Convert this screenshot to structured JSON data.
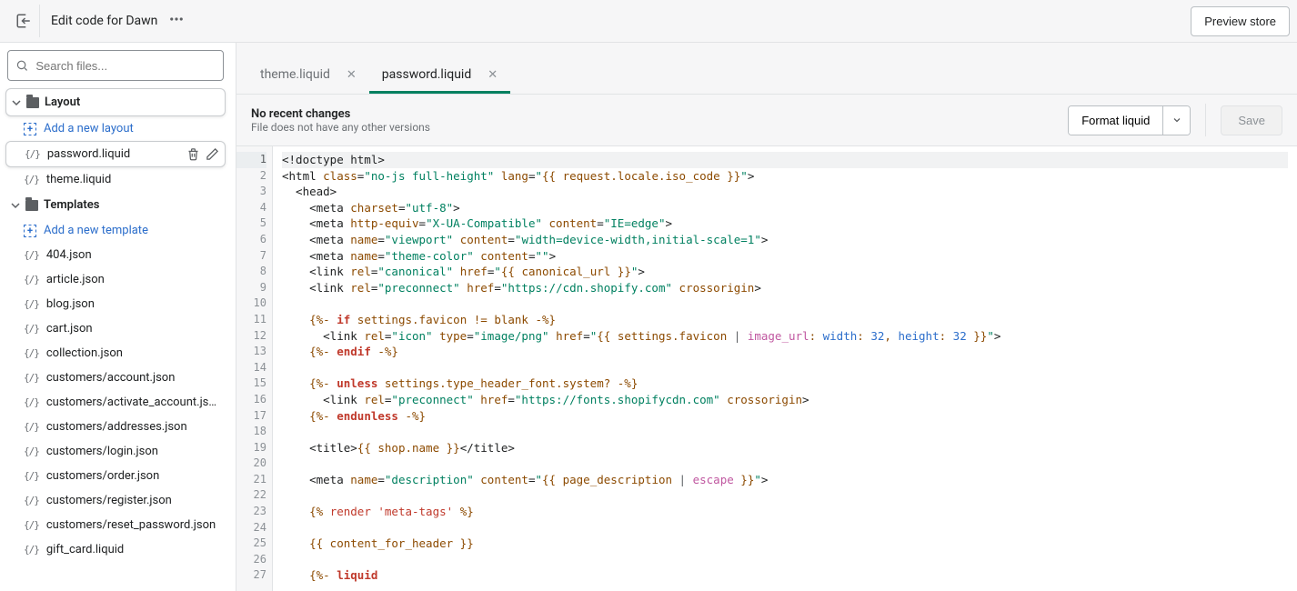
{
  "topbar": {
    "title": "Edit code for Dawn",
    "preview_label": "Preview store"
  },
  "search": {
    "placeholder": "Search files..."
  },
  "sidebar": {
    "folders": [
      {
        "name": "Layout",
        "highlighted": true,
        "add_label": "Add a new layout",
        "files": [
          {
            "name": "password.liquid",
            "active": true
          },
          {
            "name": "theme.liquid"
          }
        ]
      },
      {
        "name": "Templates",
        "add_label": "Add a new template",
        "files": [
          {
            "name": "404.json"
          },
          {
            "name": "article.json"
          },
          {
            "name": "blog.json"
          },
          {
            "name": "cart.json"
          },
          {
            "name": "collection.json"
          },
          {
            "name": "customers/account.json"
          },
          {
            "name": "customers/activate_account.json"
          },
          {
            "name": "customers/addresses.json"
          },
          {
            "name": "customers/login.json"
          },
          {
            "name": "customers/order.json"
          },
          {
            "name": "customers/register.json"
          },
          {
            "name": "customers/reset_password.json"
          },
          {
            "name": "gift_card.liquid"
          }
        ]
      }
    ]
  },
  "tabs": [
    {
      "label": "theme.liquid",
      "active": false
    },
    {
      "label": "password.liquid",
      "active": true
    }
  ],
  "infobar": {
    "heading": "No recent changes",
    "sub": "File does not have any other versions",
    "format_label": "Format liquid",
    "save_label": "Save"
  },
  "code": {
    "selected_line": 1,
    "lines": [
      [
        [
          "t-tag",
          "<!doctype html>"
        ]
      ],
      [
        [
          "t-tag",
          "<html "
        ],
        [
          "t-attr",
          "class"
        ],
        [
          "t-tag",
          "="
        ],
        [
          "t-str",
          "\"no-js full-height\""
        ],
        [
          "t-tag",
          " "
        ],
        [
          "t-attr",
          "lang"
        ],
        [
          "t-tag",
          "="
        ],
        [
          "t-str",
          "\""
        ],
        [
          "t-obj",
          "{{ request.locale.iso_code }}"
        ],
        [
          "t-str",
          "\""
        ],
        [
          "t-tag",
          ">"
        ]
      ],
      [
        [
          "t-tag",
          "  <head>"
        ]
      ],
      [
        [
          "t-tag",
          "    <meta "
        ],
        [
          "t-attr",
          "charset"
        ],
        [
          "t-tag",
          "="
        ],
        [
          "t-str",
          "\"utf-8\""
        ],
        [
          "t-tag",
          ">"
        ]
      ],
      [
        [
          "t-tag",
          "    <meta "
        ],
        [
          "t-attr",
          "http-equiv"
        ],
        [
          "t-tag",
          "="
        ],
        [
          "t-str",
          "\"X-UA-Compatible\""
        ],
        [
          "t-tag",
          " "
        ],
        [
          "t-attr",
          "content"
        ],
        [
          "t-tag",
          "="
        ],
        [
          "t-str",
          "\"IE=edge\""
        ],
        [
          "t-tag",
          ">"
        ]
      ],
      [
        [
          "t-tag",
          "    <meta "
        ],
        [
          "t-attr",
          "name"
        ],
        [
          "t-tag",
          "="
        ],
        [
          "t-str",
          "\"viewport\""
        ],
        [
          "t-tag",
          " "
        ],
        [
          "t-attr",
          "content"
        ],
        [
          "t-tag",
          "="
        ],
        [
          "t-str",
          "\"width=device-width,initial-scale=1\""
        ],
        [
          "t-tag",
          ">"
        ]
      ],
      [
        [
          "t-tag",
          "    <meta "
        ],
        [
          "t-attr",
          "name"
        ],
        [
          "t-tag",
          "="
        ],
        [
          "t-str",
          "\"theme-color\""
        ],
        [
          "t-tag",
          " "
        ],
        [
          "t-attr",
          "content"
        ],
        [
          "t-tag",
          "="
        ],
        [
          "t-str",
          "\"\""
        ],
        [
          "t-tag",
          ">"
        ]
      ],
      [
        [
          "t-tag",
          "    <link "
        ],
        [
          "t-attr",
          "rel"
        ],
        [
          "t-tag",
          "="
        ],
        [
          "t-str",
          "\"canonical\""
        ],
        [
          "t-tag",
          " "
        ],
        [
          "t-attr",
          "href"
        ],
        [
          "t-tag",
          "="
        ],
        [
          "t-str",
          "\""
        ],
        [
          "t-obj",
          "{{ canonical_url }}"
        ],
        [
          "t-str",
          "\""
        ],
        [
          "t-tag",
          ">"
        ]
      ],
      [
        [
          "t-tag",
          "    <link "
        ],
        [
          "t-attr",
          "rel"
        ],
        [
          "t-tag",
          "="
        ],
        [
          "t-str",
          "\"preconnect\""
        ],
        [
          "t-tag",
          " "
        ],
        [
          "t-attr",
          "href"
        ],
        [
          "t-tag",
          "="
        ],
        [
          "t-str",
          "\"https://cdn.shopify.com\""
        ],
        [
          "t-tag",
          " "
        ],
        [
          "t-attr",
          "crossorigin"
        ],
        [
          "t-tag",
          ">"
        ]
      ],
      [],
      [
        [
          "t-liq",
          "    {%- "
        ],
        [
          "t-kw",
          "if"
        ],
        [
          "t-liq",
          " settings.favicon != blank -%}"
        ]
      ],
      [
        [
          "t-tag",
          "      <link "
        ],
        [
          "t-attr",
          "rel"
        ],
        [
          "t-tag",
          "="
        ],
        [
          "t-str",
          "\"icon\""
        ],
        [
          "t-tag",
          " "
        ],
        [
          "t-attr",
          "type"
        ],
        [
          "t-tag",
          "="
        ],
        [
          "t-str",
          "\"image/png\""
        ],
        [
          "t-tag",
          " "
        ],
        [
          "t-attr",
          "href"
        ],
        [
          "t-tag",
          "="
        ],
        [
          "t-str",
          "\""
        ],
        [
          "t-obj",
          "{{ settings.favicon "
        ],
        [
          "t-pipe",
          "| "
        ],
        [
          "t-filter",
          "image_url"
        ],
        [
          "t-obj",
          ": "
        ],
        [
          "t-prop",
          "width"
        ],
        [
          "t-obj",
          ": "
        ],
        [
          "t-num",
          "32"
        ],
        [
          "t-obj",
          ", "
        ],
        [
          "t-prop",
          "height"
        ],
        [
          "t-obj",
          ": "
        ],
        [
          "t-num",
          "32"
        ],
        [
          "t-obj",
          " }}"
        ],
        [
          "t-str",
          "\""
        ],
        [
          "t-tag",
          ">"
        ]
      ],
      [
        [
          "t-liq",
          "    {%- "
        ],
        [
          "t-kw",
          "endif"
        ],
        [
          "t-liq",
          " -%}"
        ]
      ],
      [],
      [
        [
          "t-liq",
          "    {%- "
        ],
        [
          "t-kw",
          "unless"
        ],
        [
          "t-liq",
          " settings.type_header_font.system? -%}"
        ]
      ],
      [
        [
          "t-tag",
          "      <link "
        ],
        [
          "t-attr",
          "rel"
        ],
        [
          "t-tag",
          "="
        ],
        [
          "t-str",
          "\"preconnect\""
        ],
        [
          "t-tag",
          " "
        ],
        [
          "t-attr",
          "href"
        ],
        [
          "t-tag",
          "="
        ],
        [
          "t-str",
          "\"https://fonts.shopifycdn.com\""
        ],
        [
          "t-tag",
          " "
        ],
        [
          "t-attr",
          "crossorigin"
        ],
        [
          "t-tag",
          ">"
        ]
      ],
      [
        [
          "t-liq",
          "    {%- "
        ],
        [
          "t-kw",
          "endunless"
        ],
        [
          "t-liq",
          " -%}"
        ]
      ],
      [],
      [
        [
          "t-tag",
          "    <title>"
        ],
        [
          "t-obj",
          "{{ shop.name }}"
        ],
        [
          "t-tag",
          "</title>"
        ]
      ],
      [],
      [
        [
          "t-tag",
          "    <meta "
        ],
        [
          "t-attr",
          "name"
        ],
        [
          "t-tag",
          "="
        ],
        [
          "t-str",
          "\"description\""
        ],
        [
          "t-tag",
          " "
        ],
        [
          "t-attr",
          "content"
        ],
        [
          "t-tag",
          "="
        ],
        [
          "t-str",
          "\""
        ],
        [
          "t-obj",
          "{{ page_description "
        ],
        [
          "t-pipe",
          "| "
        ],
        [
          "t-filter",
          "escape"
        ],
        [
          "t-obj",
          " }}"
        ],
        [
          "t-str",
          "\""
        ],
        [
          "t-tag",
          ">"
        ]
      ],
      [],
      [
        [
          "t-liq",
          "    {% "
        ],
        [
          "t-render",
          "render"
        ],
        [
          "t-liq",
          " "
        ],
        [
          "t-rstr",
          "'meta-tags'"
        ],
        [
          "t-liq",
          " %}"
        ]
      ],
      [],
      [
        [
          "t-obj",
          "    {{ content_for_header }}"
        ]
      ],
      [],
      [
        [
          "t-liq",
          "    {%- "
        ],
        [
          "t-kw",
          "liquid"
        ]
      ]
    ]
  }
}
